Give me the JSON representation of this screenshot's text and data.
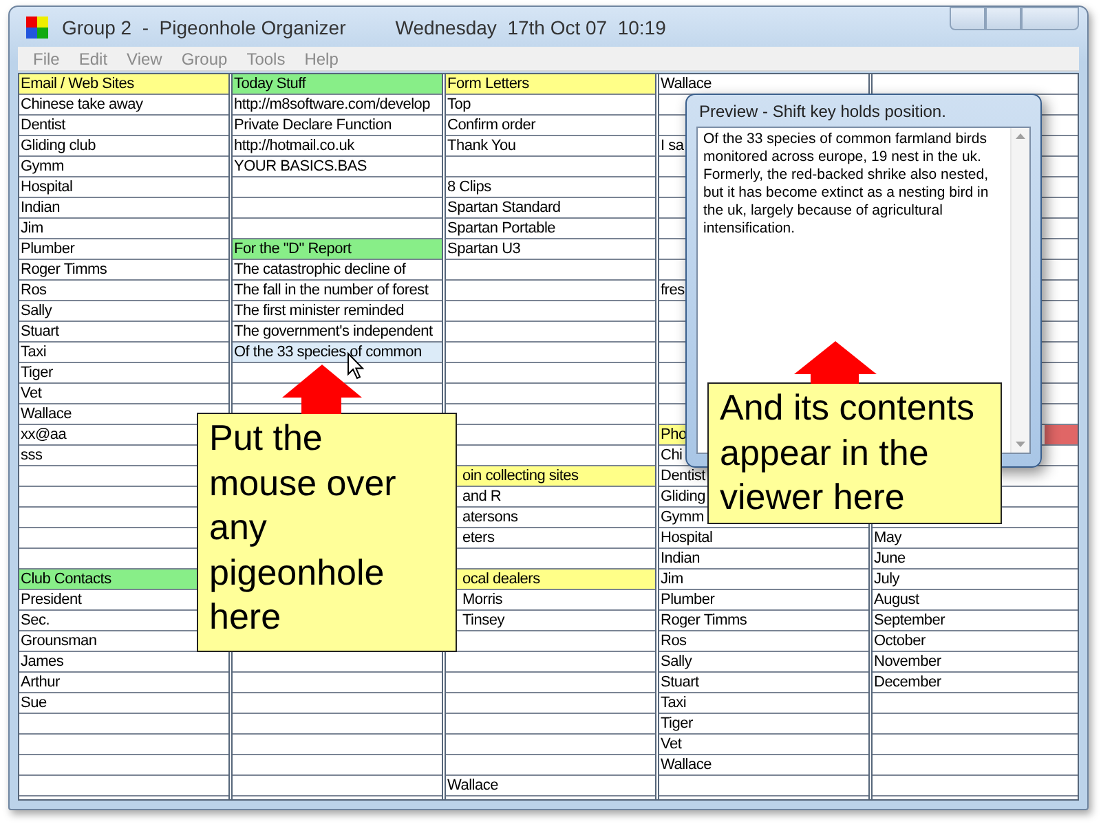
{
  "window": {
    "title": "Group 2  -  Pigeonhole Organizer",
    "clock": "Wednesday  17th Oct 07  10:19"
  },
  "menu": [
    "File",
    "Edit",
    "View",
    "Group",
    "Tools",
    "Help"
  ],
  "columns": [
    {
      "cells": [
        {
          "text": "Email / Web Sites",
          "color": "#ffff88",
          "hovered": false
        },
        {
          "text": "Chinese take away",
          "hovered": false
        },
        {
          "text": "Dentist",
          "hovered": false
        },
        {
          "text": "Gliding club",
          "hovered": false
        },
        {
          "text": "Gymm",
          "hovered": false
        },
        {
          "text": "Hospital",
          "hovered": false
        },
        {
          "text": "Indian",
          "hovered": false
        },
        {
          "text": "Jim",
          "hovered": false
        },
        {
          "text": "Plumber",
          "hovered": false
        },
        {
          "text": "Roger Timms",
          "hovered": false
        },
        {
          "text": "Ros",
          "hovered": false
        },
        {
          "text": "Sally",
          "hovered": false
        },
        {
          "text": "Stuart",
          "hovered": false
        },
        {
          "text": "Taxi",
          "hovered": false
        },
        {
          "text": "Tiger",
          "hovered": false
        },
        {
          "text": "Vet",
          "hovered": false
        },
        {
          "text": "Wallace",
          "hovered": false
        },
        {
          "text": "xx@aa",
          "hovered": false
        },
        {
          "text": "sss",
          "hovered": false
        },
        {
          "hovered": false
        },
        {
          "hovered": false
        },
        {
          "hovered": false
        },
        {
          "hovered": false
        },
        {
          "hovered": false
        },
        {
          "text": "Club Contacts",
          "color": "#88ee88",
          "hovered": false
        },
        {
          "text": "President",
          "hovered": false
        },
        {
          "text": "Sec.",
          "hovered": false
        },
        {
          "text": "Grounsman",
          "hovered": false
        },
        {
          "text": "James",
          "hovered": false
        },
        {
          "text": "Arthur",
          "hovered": false
        },
        {
          "text": "Sue",
          "hovered": false
        },
        {
          "hovered": false
        },
        {
          "hovered": false
        },
        {
          "hovered": false
        },
        {
          "hovered": false
        }
      ]
    },
    {
      "cells": [
        {
          "text": "Today Stuff",
          "color": "#88ee88",
          "hovered": false
        },
        {
          "text": "http://m8software.com/develop",
          "hovered": false
        },
        {
          "text": "Private Declare Function",
          "hovered": false
        },
        {
          "text": "http://hotmail.co.uk",
          "hovered": false
        },
        {
          "text": "YOUR BASICS.BAS",
          "hovered": false
        },
        {
          "hovered": false
        },
        {
          "hovered": false
        },
        {
          "hovered": false
        },
        {
          "text": "For the \"D\" Report",
          "color": "#88ee88",
          "hovered": false
        },
        {
          "text": "The catastrophic decline of",
          "hovered": false
        },
        {
          "text": "The fall in the number of forest",
          "hovered": false
        },
        {
          "text": "The first minister reminded",
          "hovered": false
        },
        {
          "text": "The government's independent",
          "hovered": false
        },
        {
          "text": "Of the 33 species of common",
          "hovered": true
        },
        {
          "hovered": false
        },
        {
          "hovered": false
        },
        {},
        {},
        {},
        {},
        {},
        {},
        {},
        {},
        {},
        {},
        {},
        {},
        {
          "hovered": false
        },
        {
          "hovered": false
        },
        {
          "hovered": false
        },
        {
          "hovered": false
        },
        {
          "hovered": false
        },
        {
          "hovered": false
        },
        {
          "hovered": false
        }
      ]
    },
    {
      "cells": [
        {
          "text": "Form Letters",
          "color": "#ffff88",
          "hovered": false
        },
        {
          "text": "Top",
          "hovered": false
        },
        {
          "text": "Confirm order",
          "hovered": false
        },
        {
          "text": "Thank You",
          "hovered": false
        },
        {
          "hovered": false
        },
        {
          "text": "8 Clips",
          "hovered": false
        },
        {
          "text": "Spartan Standard",
          "hovered": false
        },
        {
          "text": "Spartan Portable",
          "hovered": false
        },
        {
          "text": "Spartan U3",
          "hovered": false
        },
        {
          "hovered": false
        },
        {
          "hovered": false
        },
        {
          "hovered": false
        },
        {
          "hovered": false
        },
        {
          "hovered": false
        },
        {
          "hovered": false
        },
        {
          "hovered": false
        },
        {
          "hovered": false
        },
        {
          "hovered": false
        },
        {
          "hovered": false
        },
        {
          "text": "oin collecting sites",
          "color": "#ffff88",
          "hovered": false
        },
        {
          "text": "and R",
          "hovered": false
        },
        {
          "text": "atersons",
          "hovered": false
        },
        {
          "text": "eters",
          "hovered": false
        },
        {
          "hovered": false
        },
        {
          "text": "ocal dealers",
          "color": "#ffff88",
          "hovered": false
        },
        {
          "text": "Morris",
          "hovered": false
        },
        {
          "text": "Tinsey",
          "hovered": false
        },
        {
          "hovered": false
        },
        {
          "hovered": false
        },
        {
          "hovered": false
        },
        {
          "hovered": false
        },
        {
          "hovered": false
        },
        {
          "hovered": false
        },
        {
          "hovered": false
        },
        {
          "text": "Wallace",
          "hovered": false
        }
      ]
    },
    {
      "cells": [
        {
          "text": "Wallace",
          "hovered": false
        },
        {
          "hovered": false
        },
        {
          "hovered": false
        },
        {
          "text": "I sa",
          "hovered": false
        },
        {
          "hovered": false
        },
        {
          "hovered": false
        },
        {
          "hovered": false
        },
        {
          "hovered": false
        },
        {
          "hovered": false
        },
        {
          "hovered": false
        },
        {
          "text": "fres",
          "hovered": false
        },
        {
          "hovered": false
        },
        {
          "hovered": false
        },
        {
          "hovered": false
        },
        {
          "hovered": false
        },
        {
          "hovered": false
        },
        {
          "hovered": false
        },
        {
          "text": "Pho",
          "color": "#ffff88",
          "hovered": false
        },
        {
          "text": "Chi",
          "hovered": false
        },
        {
          "text": "Dentist",
          "hovered": false
        },
        {
          "text": "Gliding",
          "hovered": false
        },
        {
          "text": "Gymm",
          "hovered": false
        },
        {
          "text": "Hospital",
          "hovered": false
        },
        {
          "text": "Indian",
          "hovered": false
        },
        {
          "text": "Jim",
          "hovered": false
        },
        {
          "text": "Plumber",
          "hovered": false
        },
        {
          "text": "Roger Timms",
          "hovered": false
        },
        {
          "text": "Ros",
          "hovered": false
        },
        {
          "text": "Sally",
          "hovered": false
        },
        {
          "text": "Stuart",
          "hovered": false
        },
        {
          "text": "Taxi",
          "hovered": false
        },
        {
          "text": "Tiger",
          "hovered": false
        },
        {
          "text": "Vet",
          "hovered": false
        },
        {
          "text": "Wallace",
          "hovered": false
        },
        {
          "hovered": false
        }
      ]
    },
    {
      "cells": [
        {
          "hovered": false
        },
        {
          "hovered": false
        },
        {
          "hovered": false
        },
        {
          "hovered": false
        },
        {
          "hovered": false
        },
        {
          "hovered": false
        },
        {
          "hovered": false
        },
        {
          "hovered": false
        },
        {
          "hovered": false
        },
        {
          "hovered": false
        },
        {
          "hovered": false
        },
        {
          "hovered": false
        },
        {
          "hovered": false
        },
        {
          "hovered": false
        },
        {
          "hovered": false
        },
        {
          "hovered": false
        },
        {
          "hovered": false
        },
        {
          "color": "#e06666",
          "hovered": false
        },
        {
          "hovered": false
        },
        {
          "hovered": false
        },
        {
          "hovered": false
        },
        {
          "hovered": false
        },
        {
          "text": "May",
          "hovered": false
        },
        {
          "text": "June",
          "hovered": false
        },
        {
          "text": "July",
          "hovered": false
        },
        {
          "text": "August",
          "hovered": false
        },
        {
          "text": "September",
          "hovered": false
        },
        {
          "text": "October",
          "hovered": false
        },
        {
          "text": "November",
          "hovered": false
        },
        {
          "text": "December",
          "hovered": false
        },
        {
          "hovered": false
        },
        {
          "hovered": false
        },
        {
          "hovered": false
        },
        {
          "hovered": false
        },
        {
          "hovered": false
        }
      ]
    }
  ],
  "preview": {
    "title": "Preview - Shift key holds position.",
    "text": "Of the 33 species of common farmland birds monitored across europe, 19 nest in the uk. Formerly, the red-backed shrike also nested, but it has become extinct as a nesting bird in the uk, largely because of agricultural intensification."
  },
  "notes": [
    "Put the mouse over any pigeonhole here",
    "And its contents appear in the viewer here"
  ]
}
